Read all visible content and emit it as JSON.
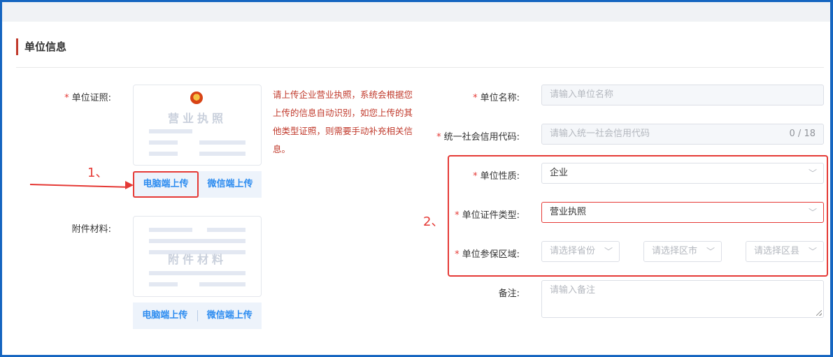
{
  "section": {
    "title": "单位信息"
  },
  "left": {
    "license_label": "单位证照:",
    "license_placeholder_text": "营业执照",
    "attach_label": "附件材料:",
    "attach_placeholder_text": "附件材料",
    "pc_upload": "电脑端上传",
    "wechat_upload": "微信端上传",
    "hint": "请上传企业营业执照，系统会根据您上传的信息自动识别，如您上传的其他类型证照，则需要手动补充相关信息。"
  },
  "form": {
    "name_label": "单位名称:",
    "name_placeholder": "请输入单位名称",
    "credit_label": "统一社会信用代码:",
    "credit_placeholder": "请输入统一社会信用代码",
    "credit_count": "0 / 18",
    "nature_label": "单位性质:",
    "nature_value": "企业",
    "cert_type_label": "单位证件类型:",
    "cert_type_value": "营业执照",
    "region_label": "单位参保区域:",
    "province_placeholder": "请选择省份",
    "city_placeholder": "请选择区市",
    "county_placeholder": "请选择区县",
    "remark_label": "备注:",
    "remark_placeholder": "请输入备注"
  },
  "annotations": {
    "one": "1、",
    "two": "2、"
  },
  "colors": {
    "accent": "#2d8cf0",
    "required": "#e53935",
    "hint": "#c0392b",
    "frame": "#1565c0"
  }
}
